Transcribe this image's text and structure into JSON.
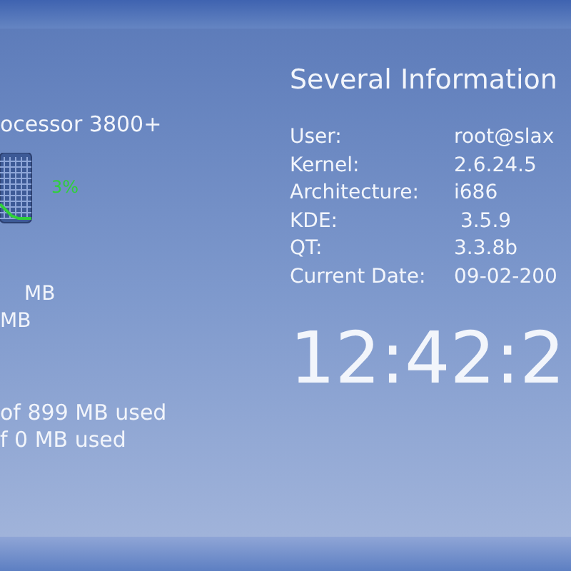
{
  "processor": {
    "name": "ocessor 3800+",
    "load": "3%"
  },
  "memory": {
    "lines": [
      "MB",
      "MB"
    ]
  },
  "swap": {
    "lines": [
      "of 899 MB used",
      "f 0 MB used"
    ]
  },
  "info": {
    "title": "Several Information",
    "rows": [
      {
        "label": "User:",
        "value": "root@slax"
      },
      {
        "label": "Kernel:",
        "value": "2.6.24.5"
      },
      {
        "label": "Architecture:",
        "value": "i686"
      },
      {
        "label": "KDE:",
        "value": " 3.5.9"
      },
      {
        "label": "QT:",
        "value": "3.3.8b"
      },
      {
        "label": "Current Date:",
        "value": "09-02-200"
      }
    ]
  },
  "clock": "12:42:2"
}
